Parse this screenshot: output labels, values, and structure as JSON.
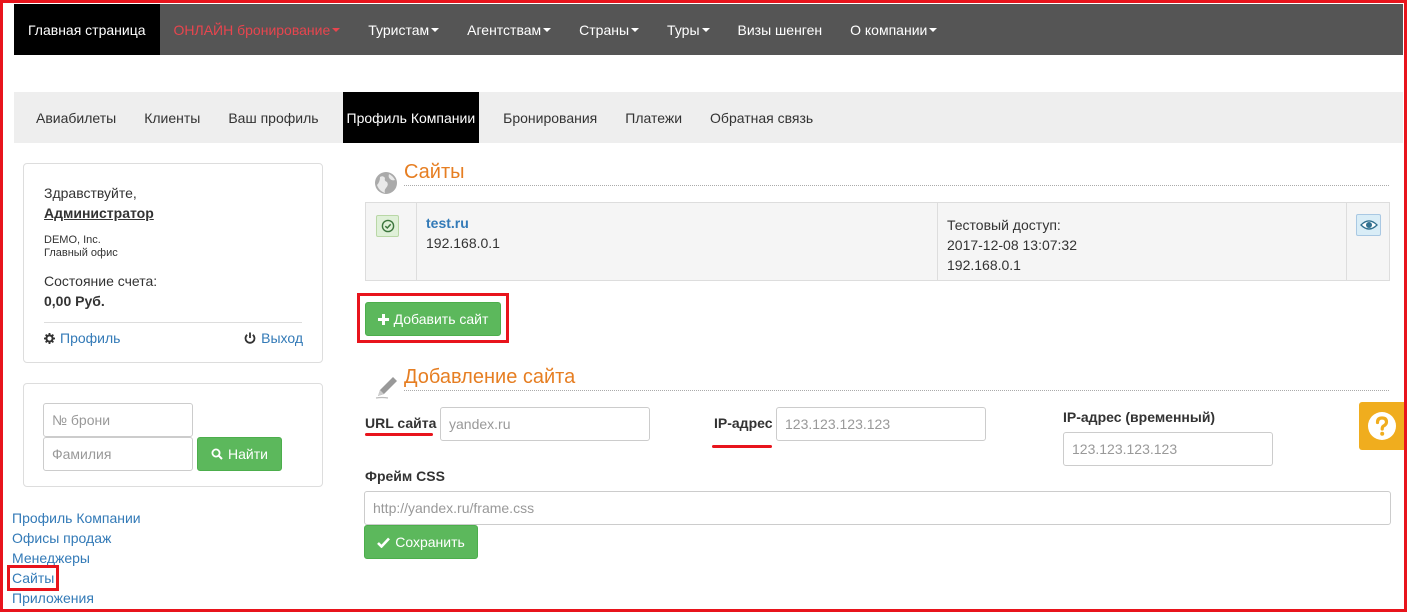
{
  "topnav": {
    "items": [
      {
        "label": "Главная страница",
        "caret": false
      },
      {
        "label": "ОНЛАЙН бронирование",
        "caret": true
      },
      {
        "label": "Туристам",
        "caret": true
      },
      {
        "label": "Агентствам",
        "caret": true
      },
      {
        "label": "Страны",
        "caret": true
      },
      {
        "label": "Туры",
        "caret": true
      },
      {
        "label": "Визы шенген",
        "caret": false
      },
      {
        "label": "О компании",
        "caret": true
      }
    ]
  },
  "subnav": {
    "items": [
      "Авиабилеты",
      "Клиенты",
      "Ваш профиль",
      "Профиль Компании",
      "Бронирования",
      "Платежи",
      "Обратная связь"
    ]
  },
  "user_panel": {
    "greeting": "Здравствуйте,",
    "username": "Администратор",
    "company": "DEMO, Inc.",
    "office": "Главный офис",
    "balance_label": "Состояние счета:",
    "balance": "0,00 Руб.",
    "profile_link": "Профиль",
    "logout_link": "Выход"
  },
  "search_panel": {
    "booking_placeholder": "№ брони",
    "surname_placeholder": "Фамилия",
    "find_button": "Найти"
  },
  "side_links": [
    "Профиль Компании",
    "Офисы продаж",
    "Менеджеры",
    "Сайты",
    "Приложения"
  ],
  "sites": {
    "title": "Сайты",
    "rows": [
      {
        "domain": "test.ru",
        "ip": "192.168.0.1",
        "test_access_label": "Тестовый доступ:",
        "test_access_date": "2017-12-08 13:07:32",
        "test_access_ip": "192.168.0.1"
      }
    ],
    "add_button": "Добавить сайт"
  },
  "add_site": {
    "title": "Добавление сайта",
    "url_label": "URL сайта",
    "url_placeholder": "yandex.ru",
    "ip_label": "IP-адрес",
    "ip_placeholder": "123.123.123.123",
    "ip_temp_label": "IP-адрес (временный)",
    "ip_temp_placeholder": "123.123.123.123",
    "css_label": "Фрейм CSS",
    "css_placeholder": "http://yandex.ru/frame.css",
    "save_button": "Сохранить"
  },
  "colors": {
    "accent_orange": "#e67e22",
    "green_button": "#5cb85c",
    "highlight_red": "#e8141c",
    "link_blue": "#337ab7",
    "help_yellow": "#f0ad1e"
  }
}
